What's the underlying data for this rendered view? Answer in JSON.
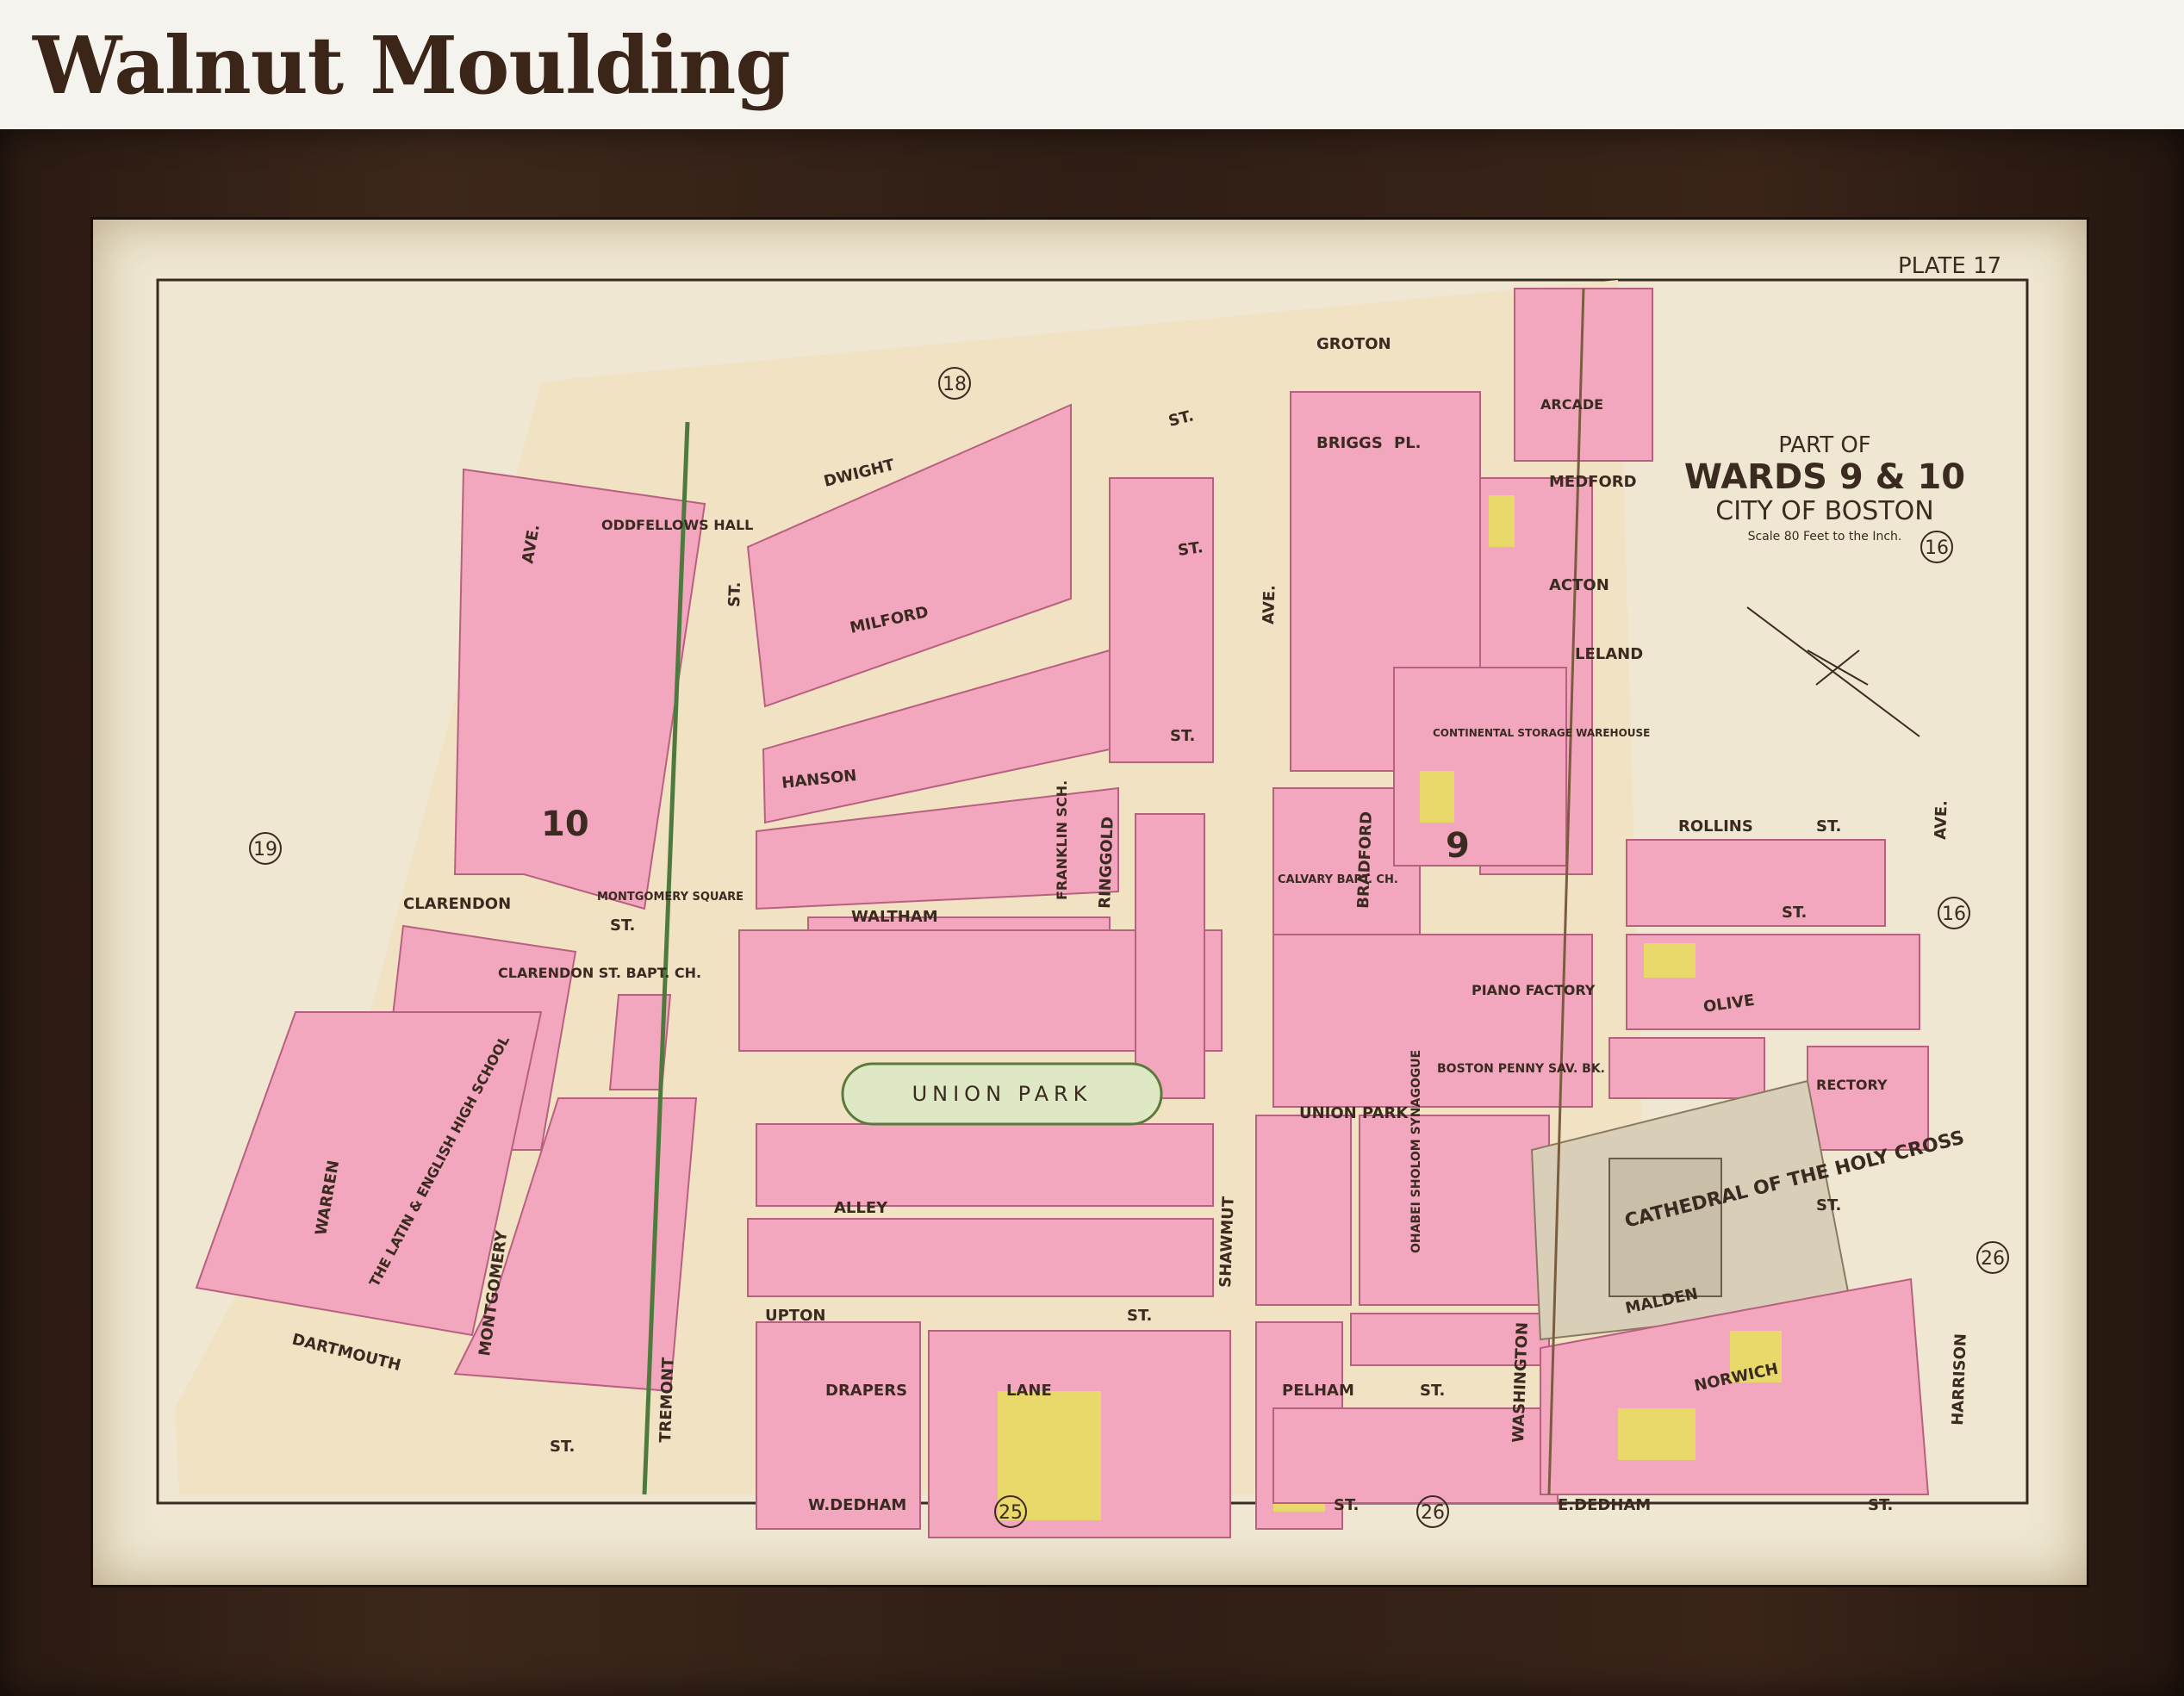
{
  "header": {
    "title": "Walnut Moulding"
  },
  "map": {
    "plate": "PLATE 17",
    "title": {
      "line1": "PART OF",
      "line2": "WARDS 9 & 10",
      "line3": "CITY OF BOSTON",
      "scale": "Scale 80 Feet to the Inch."
    },
    "ward_numbers": [
      "18",
      "16",
      "16",
      "19",
      "25",
      "26",
      "26"
    ],
    "big_wards": [
      "10",
      "9"
    ],
    "streets": {
      "groton": "GROTON",
      "dwight": "DWIGHT",
      "st_dwight": "ST.",
      "milford": "MILFORD",
      "hanson": "HANSON",
      "waltham": "WALTHAM",
      "union_park_st": "UNION PARK",
      "upton": "UPTON",
      "st_upton": "ST.",
      "w_dedham": "W.DEDHAM",
      "st_wdedham": "ST.",
      "e_dedham": "E.DEDHAM",
      "st_ededham": "ST.",
      "rollins": "ROLLINS",
      "st_rollins": "ST.",
      "clarendon": "CLARENDON",
      "dartmouth": "DARTMOUTH",
      "st_dartmouth": "ST.",
      "warren": "WARREN",
      "ave_left": "AVE.",
      "tremont": "TREMONT",
      "st_tremont": "ST.",
      "shawmut": "SHAWMUT",
      "ave_mid": "AVE.",
      "washington": "WASHINGTON",
      "harrison": "HARRISON",
      "ave_right": "AVE.",
      "montgomery": "MONTGOMERY",
      "bradford": "BRADFORD",
      "ringgold": "RINGGOLD",
      "briggs": "BRIGGS",
      "pl": "PL.",
      "medford": "MEDFORD",
      "acton": "ACTON",
      "leland": "LELAND",
      "malden": "MALDEN",
      "norwich": "NORWICH",
      "pelham": "PELHAM",
      "st_pelham": "ST.",
      "drapers": "DRAPERS",
      "lane": "LANE",
      "alley": "ALLEY",
      "olive": "OLIVE",
      "st_olive": "ST.",
      "st_malden": "ST.",
      "st_milford": "ST.",
      "st_hanson": "ST.",
      "st_clarendon": "ST."
    },
    "landmarks": {
      "oddfellows": "ODDFELLOWS HALL",
      "latin_school": "THE LATIN & ENGLISH HIGH SCHOOL",
      "clarendon_bapt": "CLARENDON ST. BAPT. CH.",
      "montgomery_sq": "MONTGOMERY SQUARE",
      "franklin": "FRANKLIN SCH.",
      "union_park": "UNION PARK",
      "piano": "PIANO FACTORY",
      "boston_bank": "BOSTON PENNY SAV. BK.",
      "ohabei": "OHABEI SHOLOM SYNAGOGUE",
      "cathedral": "CATHEDRAL OF THE HOLY CROSS",
      "continental": "CONTINENTAL STORAGE WAREHOUSE",
      "arcade": "ARCADE",
      "rectory": "RECTORY",
      "calvary": "CALVARY BAPT. CH."
    }
  }
}
